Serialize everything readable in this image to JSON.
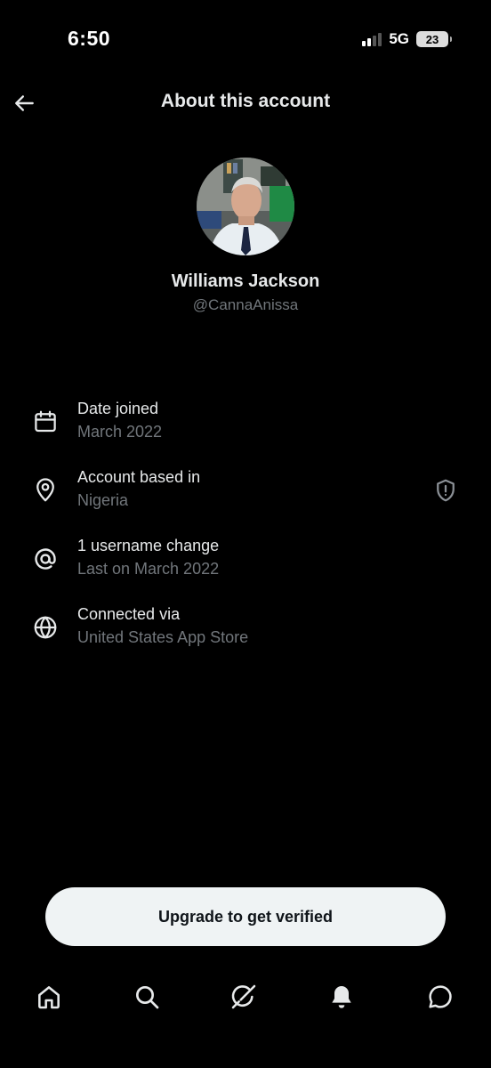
{
  "status_bar": {
    "time": "6:50",
    "network": "5G",
    "battery": "23"
  },
  "header": {
    "title": "About this account",
    "back_icon": "arrow-left-icon"
  },
  "profile": {
    "name": "Williams Jackson",
    "handle": "@CannaAnissa"
  },
  "info": [
    {
      "icon": "calendar-icon",
      "title": "Date joined",
      "subtitle": "March 2022"
    },
    {
      "icon": "location-pin-icon",
      "title": "Account based in",
      "subtitle": "Nigeria",
      "trailing_icon": "shield-alert-icon"
    },
    {
      "icon": "at-sign-icon",
      "title": "1 username change",
      "subtitle": "Last on March 2022"
    },
    {
      "icon": "globe-icon",
      "title": "Connected via",
      "subtitle": "United States App Store"
    }
  ],
  "cta": {
    "label": "Upgrade to get verified"
  },
  "bottom_nav": [
    {
      "icon": "home-icon"
    },
    {
      "icon": "search-icon"
    },
    {
      "icon": "grok-icon"
    },
    {
      "icon": "notifications-bell-icon"
    },
    {
      "icon": "messages-icon"
    }
  ],
  "colors": {
    "background": "#000000",
    "primary_text": "#e7e9ea",
    "secondary_text": "#71767b",
    "button_bg": "#eff3f4",
    "button_text": "#0f1419"
  }
}
